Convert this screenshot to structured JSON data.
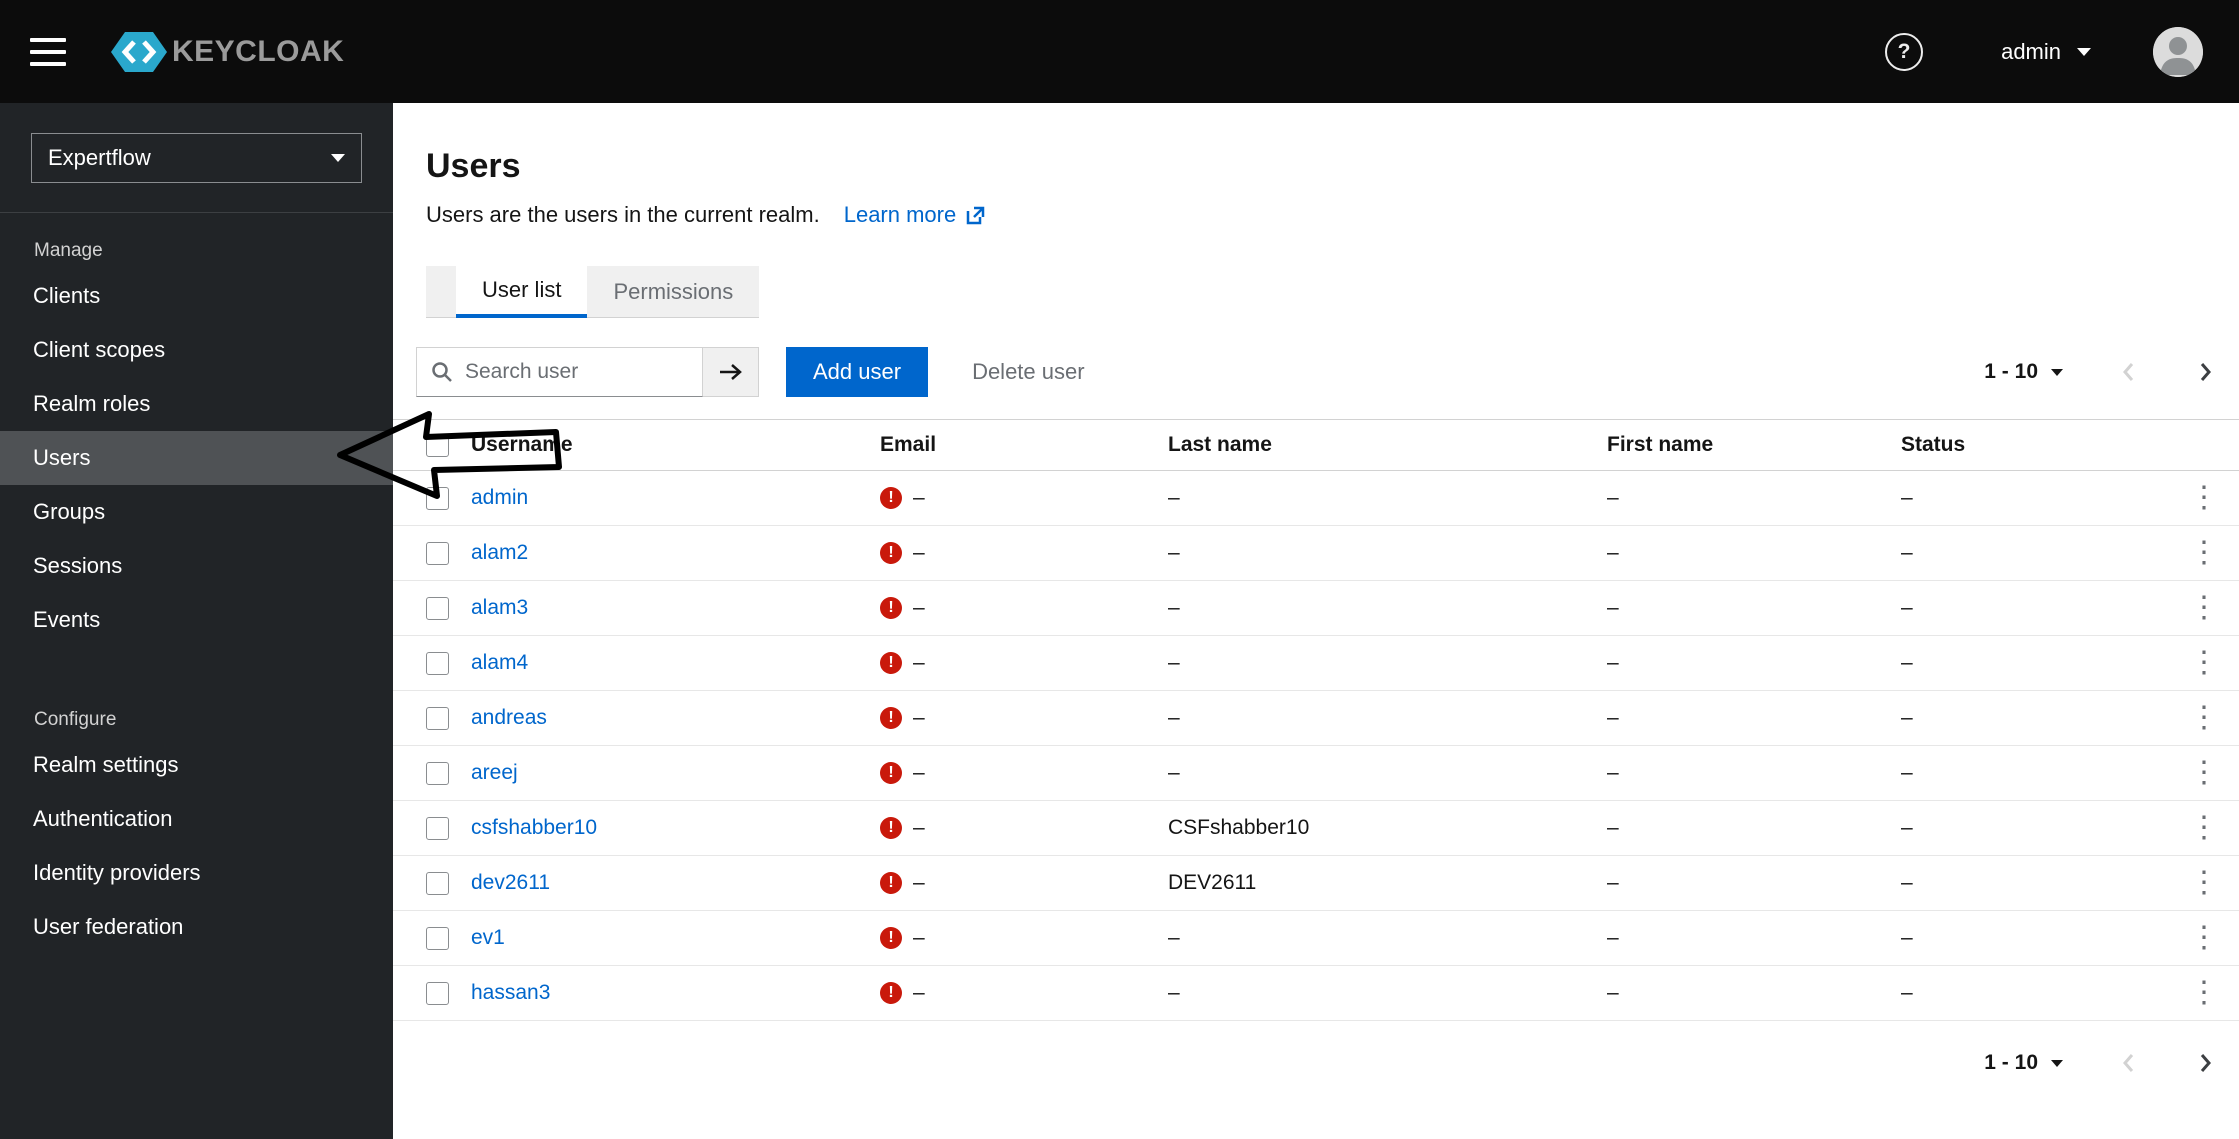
{
  "header": {
    "brand": "KEYCLOAK",
    "user": "admin"
  },
  "icons": {
    "question": "?",
    "kebab": "⋮",
    "warning": "!"
  },
  "sidebar": {
    "realm": "Expertflow",
    "sections": [
      {
        "label": "Manage",
        "items": [
          {
            "label": "Clients"
          },
          {
            "label": "Client scopes"
          },
          {
            "label": "Realm roles"
          },
          {
            "label": "Users",
            "selected": true
          },
          {
            "label": "Groups"
          },
          {
            "label": "Sessions"
          },
          {
            "label": "Events"
          }
        ]
      },
      {
        "label": "Configure",
        "items": [
          {
            "label": "Realm settings"
          },
          {
            "label": "Authentication"
          },
          {
            "label": "Identity providers"
          },
          {
            "label": "User federation"
          }
        ]
      }
    ]
  },
  "main": {
    "title": "Users",
    "subtitle": "Users are the users in the current realm.",
    "learn_more_label": "Learn more",
    "tabs": [
      {
        "label": "User list",
        "active": true
      },
      {
        "label": "Permissions",
        "active": false
      }
    ],
    "toolbar": {
      "search_placeholder": "Search user",
      "add_user": "Add user",
      "delete_user": "Delete user"
    },
    "pagination": {
      "range": "1 - 10"
    },
    "table": {
      "columns": [
        "Username",
        "Email",
        "Last name",
        "First name",
        "Status"
      ],
      "rows": [
        {
          "username": "admin",
          "email": "–",
          "last": "–",
          "first": "–",
          "status": "–"
        },
        {
          "username": "alam2",
          "email": "–",
          "last": "–",
          "first": "–",
          "status": "–"
        },
        {
          "username": "alam3",
          "email": "–",
          "last": "–",
          "first": "–",
          "status": "–"
        },
        {
          "username": "alam4",
          "email": "–",
          "last": "–",
          "first": "–",
          "status": "–"
        },
        {
          "username": "andreas",
          "email": "–",
          "last": "–",
          "first": "–",
          "status": "–"
        },
        {
          "username": "areej",
          "email": "–",
          "last": "–",
          "first": "–",
          "status": "–"
        },
        {
          "username": "csfshabber10",
          "email": "–",
          "last": "CSFshabber10",
          "first": "–",
          "status": "–"
        },
        {
          "username": "dev2611",
          "email": "–",
          "last": "DEV2611",
          "first": "–",
          "status": "–"
        },
        {
          "username": "ev1",
          "email": "–",
          "last": "–",
          "first": "–",
          "status": "–"
        },
        {
          "username": "hassan3",
          "email": "–",
          "last": "–",
          "first": "–",
          "status": "–"
        }
      ]
    }
  },
  "colors": {
    "primary": "#0066cc",
    "danger": "#c9190b",
    "link": "#0066cc",
    "masthead": "#0c0c0c",
    "sidebar": "#212427"
  }
}
